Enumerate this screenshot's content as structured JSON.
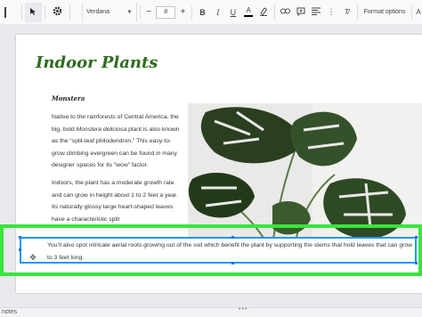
{
  "toolbar": {
    "font": "Verdana",
    "font_size": "8",
    "bold": "B",
    "italic": "I",
    "underline": "U",
    "text_color": "A",
    "format_options": "Format options"
  },
  "slide": {
    "title": "Indoor Plants",
    "subtitle": "Monstera",
    "paragraph1_a": "Native to the rainforests of Central America, the big, bold ",
    "paragraph1_italic": "Monstera deliciosa",
    "paragraph1_b": " plant is also known as the “split-leaf philodendron.” This easy-to-grow climbing evergreen can be found in many designer spaces for its “wow” factor.",
    "paragraph2": "Indoors, the plant has a moderate growth rate and can grow in height about 1 to 2 feet a year. Its naturally glossy large heart-shaped leaves have a characteristic split",
    "caption": "You’ll also spot intricate aerial roots growing out of the soil which benefit the plant by supporting the stems that hold leaves that can grow to 3 feet long."
  },
  "footer": {
    "notes_label": "notes"
  },
  "colors": {
    "title": "#2f6d1f",
    "highlight": "#39e53c",
    "selection": "#2196f3"
  }
}
